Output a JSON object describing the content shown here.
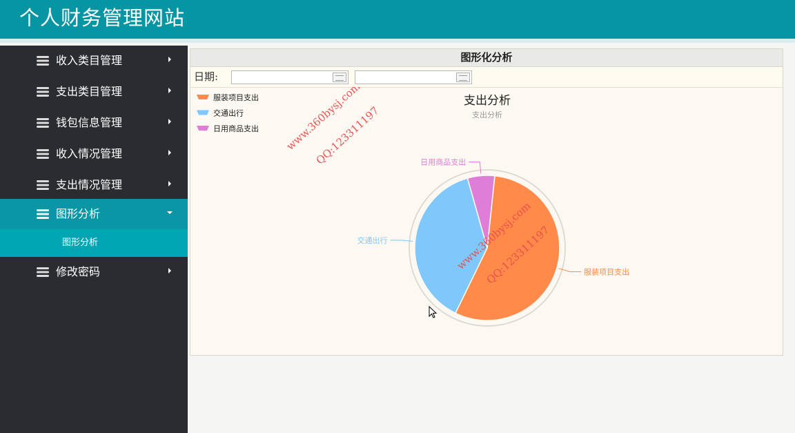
{
  "header": {
    "title": "个人财务管理网站"
  },
  "sidebar": {
    "items": [
      {
        "label": "收入类目管理"
      },
      {
        "label": "支出类目管理"
      },
      {
        "label": "钱包信息管理"
      },
      {
        "label": "收入情况管理"
      },
      {
        "label": "支出情况管理"
      },
      {
        "label": "图形分析",
        "expanded": true,
        "sub": [
          {
            "label": "图形分析"
          }
        ]
      },
      {
        "label": "修改密码"
      }
    ]
  },
  "panel": {
    "title": "图形化分析",
    "date_label": "日期:",
    "start_date": "",
    "end_date": ""
  },
  "watermark": {
    "site": "www.360bysj.com",
    "qq": "QQ:123311197"
  },
  "colors": {
    "header_bg": "#0695a3",
    "sidebar_bg": "#2b2c31",
    "active_bg": "#0a96a5",
    "sub_active_bg": "#00a6b4",
    "watermark": "#e84c4c"
  },
  "chart_data": {
    "type": "pie",
    "title": "支出分析",
    "subtitle": "支出分析",
    "legend_position": "top-left",
    "slices": [
      {
        "name": "服装项目支出",
        "value": 55,
        "color": "#ff8a4a"
      },
      {
        "name": "交通出行",
        "value": 38,
        "color": "#7ec8fc"
      },
      {
        "name": "日用商品支出",
        "value": 6,
        "color": "#df7ed8"
      }
    ]
  }
}
